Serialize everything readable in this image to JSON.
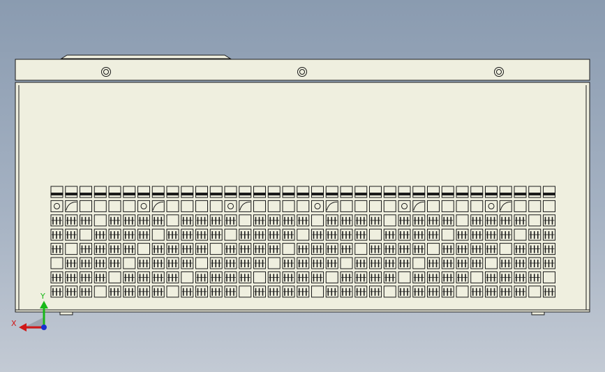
{
  "view": {
    "background_top": "#8a9bb0",
    "background_bottom": "#c3cad4",
    "body_fill": "#efefdf",
    "line_color": "#1a1a1a"
  },
  "part": {
    "vent_columns": 35,
    "vent_rows": 8
  },
  "triad": {
    "x_label": "X",
    "y_label": "Y",
    "x_color": "#d01818",
    "y_color": "#18b818",
    "z_color": "#1830d0"
  }
}
